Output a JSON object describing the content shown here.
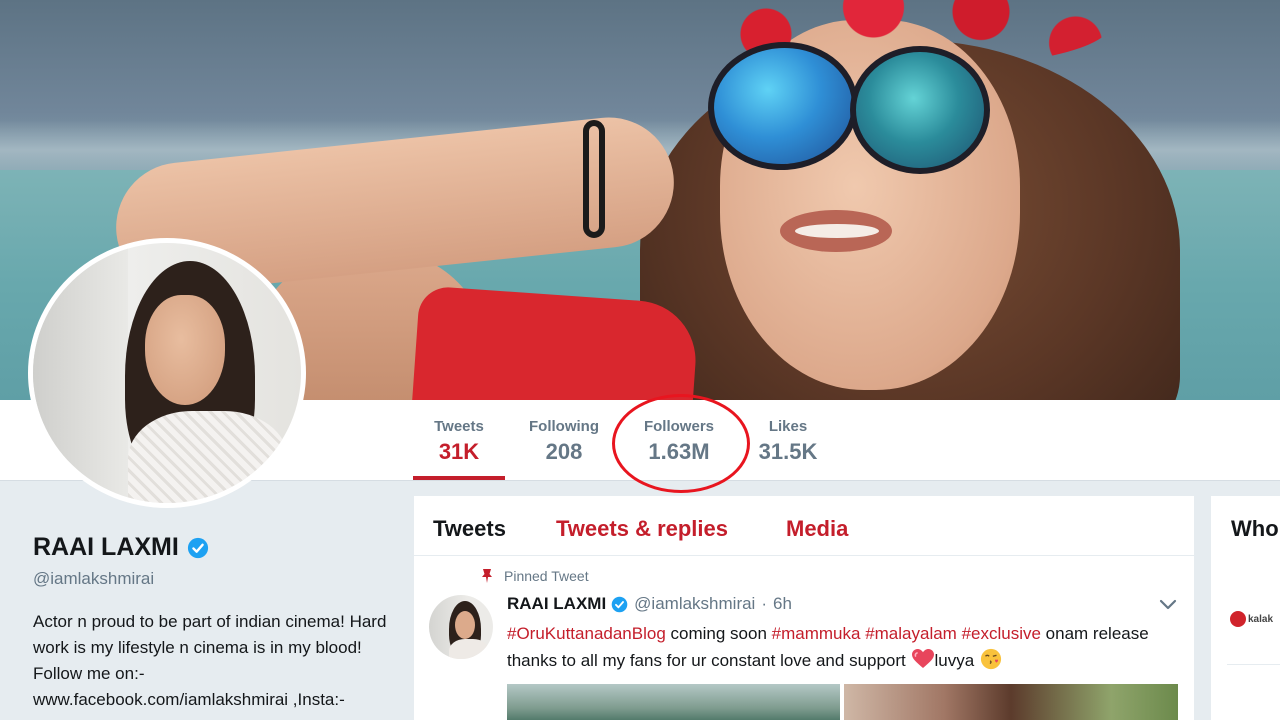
{
  "profile": {
    "name": "RAAI LAXMI",
    "handle": "@iamlakshmirai",
    "bio": "Actor n proud to be part of indian cinema! Hard work is my lifestyle n cinema is in my blood! Follow me on:- www.facebook.com/iamlakshmirai ,Insta:-"
  },
  "stats": [
    {
      "label": "Tweets",
      "value": "31K",
      "active": true
    },
    {
      "label": "Following",
      "value": "208"
    },
    {
      "label": "Followers",
      "value": "1.63M",
      "highlighted": true
    },
    {
      "label": "Likes",
      "value": "31.5K"
    }
  ],
  "tabs": [
    {
      "label": "Tweets",
      "active": true
    },
    {
      "label": "Tweets & replies"
    },
    {
      "label": "Media"
    }
  ],
  "tweet": {
    "pinned_label": "Pinned Tweet",
    "author": "RAAI LAXMI",
    "handle": "@iamlakshmirai",
    "separator": "·",
    "time": "6h",
    "hashtag1": "#OruKuttanadanBlog",
    "text1": " coming soon ",
    "hashtag2": "#mammuka",
    "hashtag3": "#malayalam",
    "hashtag4": "#exclusive",
    "text2": " onam release thanks to all my fans for ur constant love and support ",
    "text3": "luvya"
  },
  "sidebar": {
    "title": "Who",
    "logo_text": "kalak"
  },
  "colors": {
    "accent": "#c41e2b",
    "verified": "#1da1f2",
    "annotation_circle": "#e8151f"
  },
  "icons": [
    "verified-badge-icon",
    "pin-icon",
    "chevron-down-icon",
    "heart-emoji-icon",
    "kiss-emoji-icon"
  ]
}
